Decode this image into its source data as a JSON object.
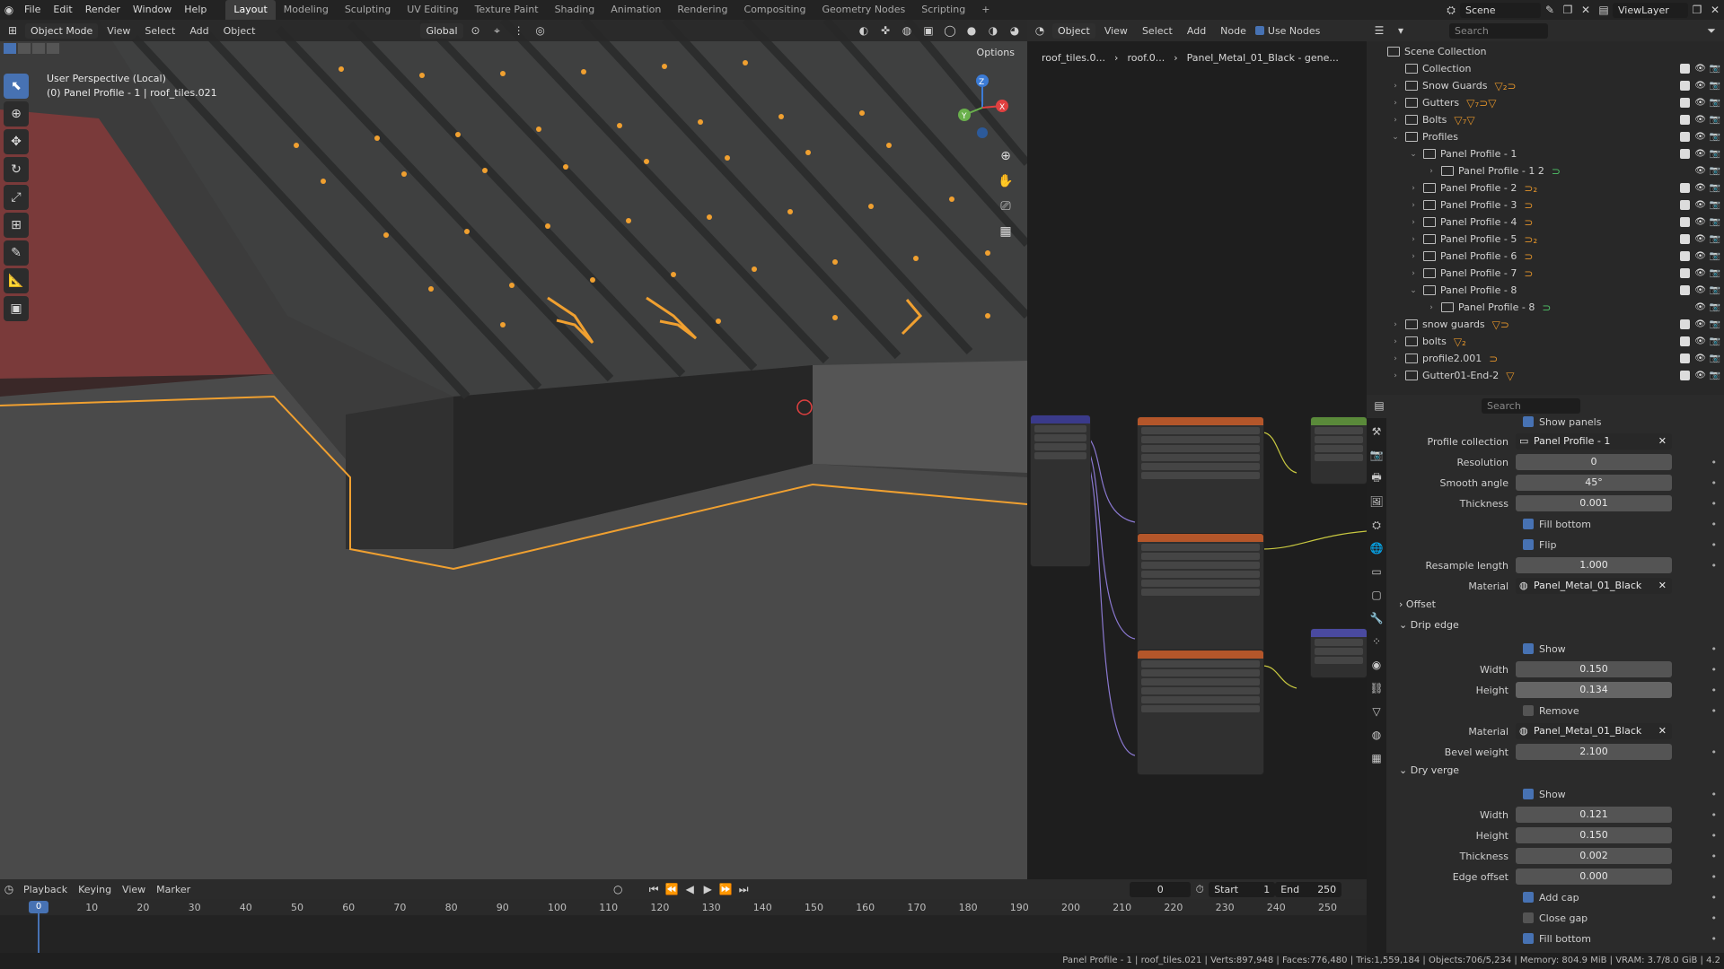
{
  "menu": [
    "File",
    "Edit",
    "Render",
    "Window",
    "Help"
  ],
  "workspaces": [
    "Layout",
    "Modeling",
    "Sculpting",
    "UV Editing",
    "Texture Paint",
    "Shading",
    "Animation",
    "Rendering",
    "Compositing",
    "Geometry Nodes",
    "Scripting"
  ],
  "active_workspace": "Layout",
  "scene": "Scene",
  "view_layer": "ViewLayer",
  "viewport": {
    "mode": "Object Mode",
    "menus": [
      "View",
      "Select",
      "Add",
      "Object"
    ],
    "transform": "Global",
    "options": "Options",
    "info_line1": "User Perspective (Local)",
    "info_line2": "(0) Panel Profile - 1 | roof_tiles.021",
    "accent": "#f0a030",
    "gizmo": {
      "x": "X",
      "y": "Y",
      "z": "Z"
    }
  },
  "node_editor": {
    "object": "Object",
    "menus": [
      "View",
      "Select",
      "Add",
      "Node"
    ],
    "use_nodes": "Use Nodes",
    "breadcrumb": [
      "roof_tiles.0...",
      "roof.0...",
      "Panel_Metal_01_Black - gene..."
    ]
  },
  "outliner": {
    "search_placeholder": "Search",
    "items": [
      {
        "name": "Scene Collection",
        "level": 0,
        "exp": "",
        "tag": "",
        "tag_color": ""
      },
      {
        "name": "Collection",
        "level": 1,
        "exp": "",
        "tag": "",
        "tag_color": ""
      },
      {
        "name": "Snow Guards",
        "level": 1,
        "exp": "›",
        "tag": "▽₂⊃",
        "tag_color": "o"
      },
      {
        "name": "Gutters",
        "level": 1,
        "exp": "›",
        "tag": "▽₇⊃▽",
        "tag_color": "o"
      },
      {
        "name": "Bolts",
        "level": 1,
        "exp": "›",
        "tag": "▽₇▽",
        "tag_color": "o"
      },
      {
        "name": "Profiles",
        "level": 1,
        "exp": "⌄",
        "tag": "",
        "tag_color": ""
      },
      {
        "name": "Panel Profile - 1",
        "level": 2,
        "exp": "⌄",
        "tag": "",
        "tag_color": ""
      },
      {
        "name": "Panel Profile - 1 2",
        "level": 3,
        "exp": "›",
        "tag": "⊃",
        "tag_color": "g"
      },
      {
        "name": "Panel Profile - 2",
        "level": 2,
        "exp": "›",
        "tag": "⊃₂",
        "tag_color": "o"
      },
      {
        "name": "Panel Profile - 3",
        "level": 2,
        "exp": "›",
        "tag": "⊃",
        "tag_color": "o"
      },
      {
        "name": "Panel Profile - 4",
        "level": 2,
        "exp": "›",
        "tag": "⊃",
        "tag_color": "o"
      },
      {
        "name": "Panel Profile - 5",
        "level": 2,
        "exp": "›",
        "tag": "⊃₂",
        "tag_color": "o"
      },
      {
        "name": "Panel Profile - 6",
        "level": 2,
        "exp": "›",
        "tag": "⊃",
        "tag_color": "o"
      },
      {
        "name": "Panel Profile - 7",
        "level": 2,
        "exp": "›",
        "tag": "⊃",
        "tag_color": "o"
      },
      {
        "name": "Panel Profile - 8",
        "level": 2,
        "exp": "⌄",
        "tag": "",
        "tag_color": ""
      },
      {
        "name": "Panel Profile - 8",
        "level": 3,
        "exp": "›",
        "tag": "⊃",
        "tag_color": "g"
      },
      {
        "name": "snow guards",
        "level": 1,
        "exp": "›",
        "tag": "▽⊃",
        "tag_color": "o"
      },
      {
        "name": "bolts",
        "level": 1,
        "exp": "›",
        "tag": "▽₂",
        "tag_color": "o"
      },
      {
        "name": "profile2.001",
        "level": 1,
        "exp": "›",
        "tag": "⊃",
        "tag_color": "o"
      },
      {
        "name": "Gutter01-End-2",
        "level": 1,
        "exp": "›",
        "tag": "▽",
        "tag_color": "o"
      }
    ]
  },
  "properties": {
    "search_placeholder": "Search",
    "show_panels": "Show panels",
    "profile_collection": {
      "label": "Profile collection",
      "value": "Panel Profile - 1"
    },
    "resolution": {
      "label": "Resolution",
      "value": "0"
    },
    "smooth_angle": {
      "label": "Smooth angle",
      "value": "45°"
    },
    "thickness": {
      "label": "Thickness",
      "value": "0.001"
    },
    "fill_bottom": "Fill bottom",
    "flip": "Flip",
    "resample_length": {
      "label": "Resample length",
      "value": "1.000"
    },
    "material": {
      "label": "Material",
      "value": "Panel_Metal_01_Black"
    },
    "offset": "Offset",
    "drip_edge": {
      "title": "Drip edge",
      "show": "Show",
      "width": {
        "label": "Width",
        "value": "0.150"
      },
      "height": {
        "label": "Height",
        "value": "0.134"
      },
      "remove": "Remove",
      "material": {
        "label": "Material",
        "value": "Panel_Metal_01_Black"
      },
      "bevel": {
        "label": "Bevel weight",
        "value": "2.100"
      }
    },
    "dry_verge": {
      "title": "Dry verge",
      "show": "Show",
      "width": {
        "label": "Width",
        "value": "0.121"
      },
      "height": {
        "label": "Height",
        "value": "0.150"
      },
      "thickness": {
        "label": "Thickness",
        "value": "0.002"
      },
      "edge_offset": {
        "label": "Edge offset",
        "value": "0.000"
      },
      "add_cap": "Add cap",
      "close_gap": "Close gap",
      "fill_bottom": "Fill bottom"
    }
  },
  "timeline": {
    "menus": [
      "Playback",
      "Keying",
      "View",
      "Marker"
    ],
    "current": "0",
    "start_label": "Start",
    "start": "1",
    "end_label": "End",
    "end": "250",
    "ticks": [
      "0",
      "10",
      "20",
      "30",
      "40",
      "50",
      "60",
      "70",
      "80",
      "90",
      "100",
      "110",
      "120",
      "130",
      "140",
      "150",
      "160",
      "170",
      "180",
      "190",
      "200",
      "210",
      "220",
      "230",
      "240",
      "250"
    ]
  },
  "status": "Panel Profile - 1 | roof_tiles.021 | Verts:897,948 | Faces:776,480 | Tris:1,559,184 | Objects:706/5,234 | Memory: 804.9 MiB | VRAM: 3.7/8.0 GiB | 4.2"
}
